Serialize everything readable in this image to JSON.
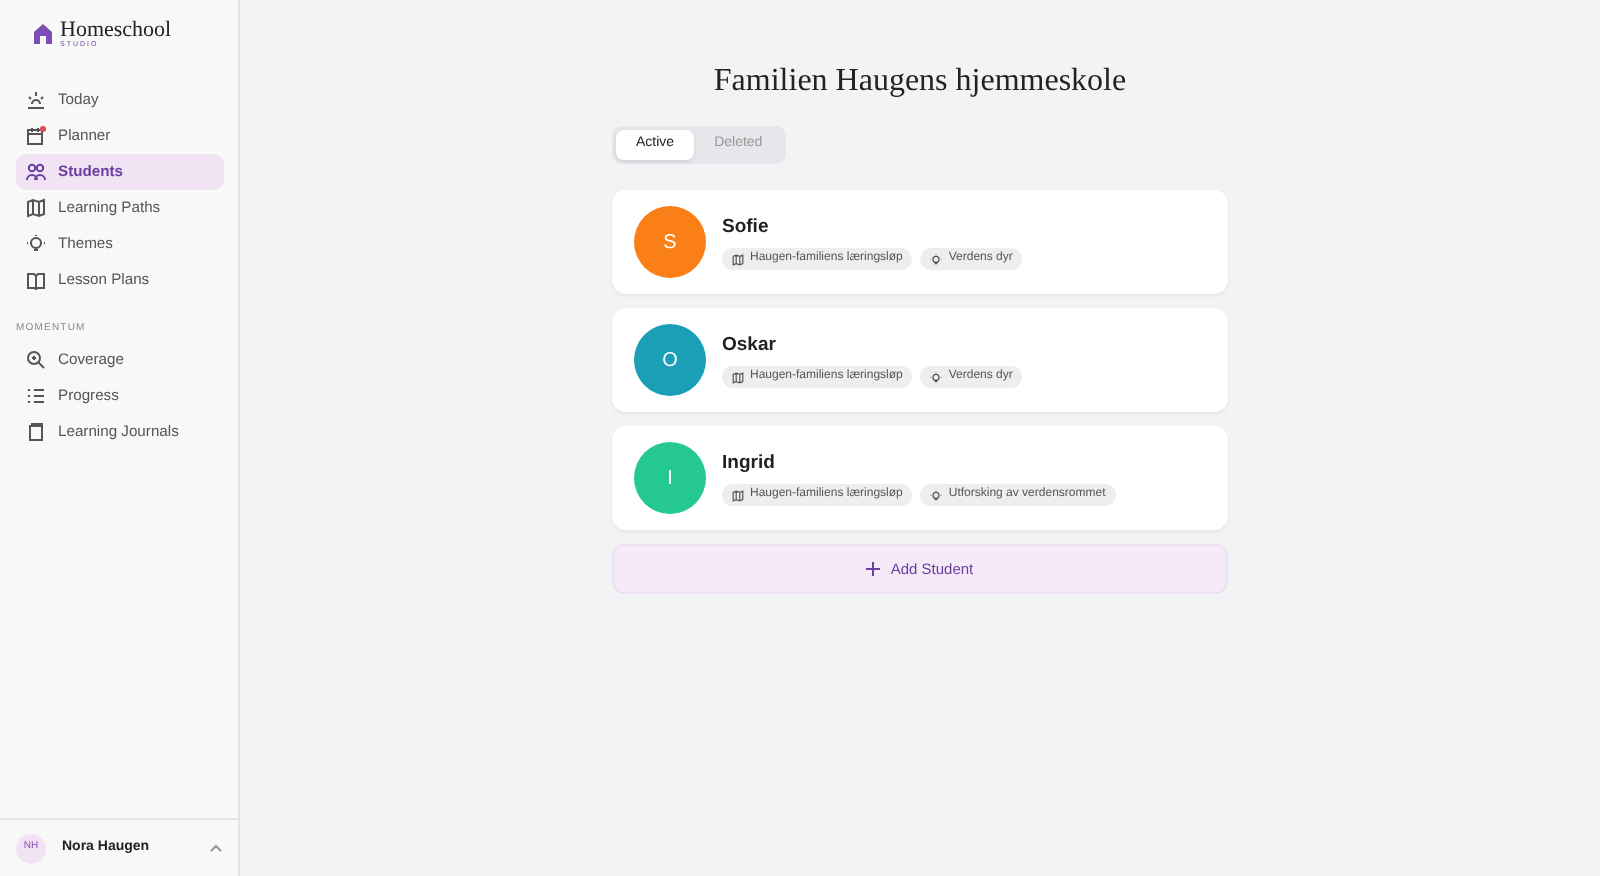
{
  "brand": {
    "name": "Homeschool",
    "tagline": "STUDIO"
  },
  "nav": [
    {
      "label": "Today",
      "selected": false,
      "notification": false
    },
    {
      "label": "Planner",
      "selected": false,
      "notification": true
    },
    {
      "label": "Students",
      "selected": true,
      "notification": false
    },
    {
      "label": "Learning Paths",
      "selected": false,
      "notification": false
    },
    {
      "label": "Themes",
      "selected": false,
      "notification": false
    },
    {
      "label": "Lesson Plans",
      "selected": false,
      "notification": false
    }
  ],
  "section": {
    "title": "MOMENTUM",
    "items": [
      {
        "label": "Coverage",
        "selected": false
      },
      {
        "label": "Progress",
        "selected": false
      },
      {
        "label": "Learning Journals",
        "selected": false
      }
    ]
  },
  "user": {
    "initials": "NH",
    "name": "Nora Haugen"
  },
  "title": "Familien Haugens hjemmeskole",
  "tabs": [
    {
      "label": "Active",
      "selected": true
    },
    {
      "label": "Deleted",
      "selected": false
    }
  ],
  "students": [
    {
      "initial": "S",
      "name": "Sofie",
      "color": "#f97f16",
      "path": "Haugen-familiens læringsløp",
      "theme": "Verdens dyr"
    },
    {
      "initial": "O",
      "name": "Oskar",
      "color": "#1a9fb6",
      "path": "Haugen-familiens læringsløp",
      "theme": "Verdens dyr"
    },
    {
      "initial": "I",
      "name": "Ingrid",
      "color": "#25c98f",
      "path": "Haugen-familiens læringsløp",
      "theme": "Utforsking av verdensrommet"
    }
  ],
  "add_button": {
    "label": "Add Student"
  }
}
